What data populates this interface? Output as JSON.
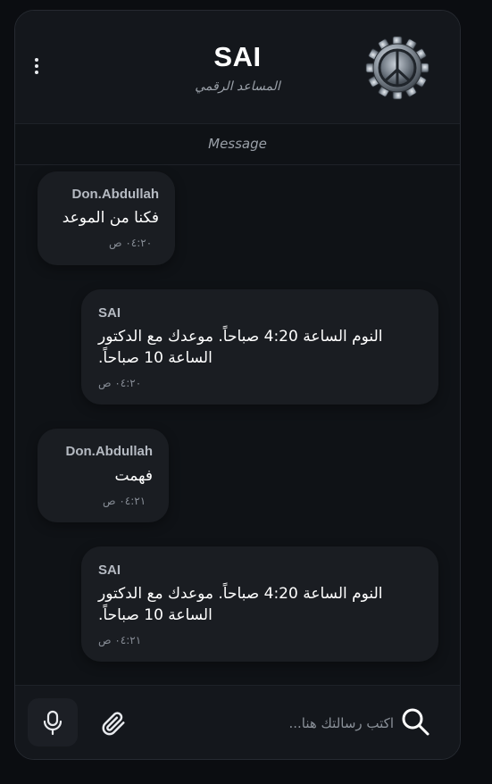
{
  "header": {
    "title": "SAI",
    "subtitle": "المساعد الرقمي",
    "menu_icon": "more-vertical-icon",
    "avatar_icon": "gear-peace-emblem-icon"
  },
  "status": {
    "label": "Message"
  },
  "messages": [
    {
      "sender": "Don.Abdullah",
      "text_lines": [
        "فكنا من الموعد"
      ],
      "time": "٠٤:٢٠ ص",
      "side": "left"
    },
    {
      "sender": "SAI",
      "text_lines": [
        "النوم الساعة 4:20 صباحاً. موعدك مع الدكتور",
        "الساعة 10 صباحاً."
      ],
      "time": "٠٤:٢٠ ص",
      "side": "right"
    },
    {
      "sender": "Don.Abdullah",
      "text_lines": [
        "فهمت"
      ],
      "time": "٠٤:٢١ ص",
      "side": "left"
    },
    {
      "sender": "SAI",
      "text_lines": [
        "النوم الساعة 4:20 صباحاً. موعدك مع الدكتور",
        "الساعة 10 صباحاً."
      ],
      "time": "٠٤:٢١ ص",
      "side": "right"
    }
  ],
  "composer": {
    "placeholder": "اكتب رسالتك هنا...",
    "value": "",
    "mic_icon": "microphone-icon",
    "attach_icon": "paperclip-icon",
    "search_icon": "search-icon"
  },
  "colors": {
    "background": "#0b0d11",
    "panel": "#0f1216",
    "header": "#14171c",
    "bubble": "#1a1d22",
    "text": "#ffffff",
    "muted": "#9aa0a8"
  }
}
